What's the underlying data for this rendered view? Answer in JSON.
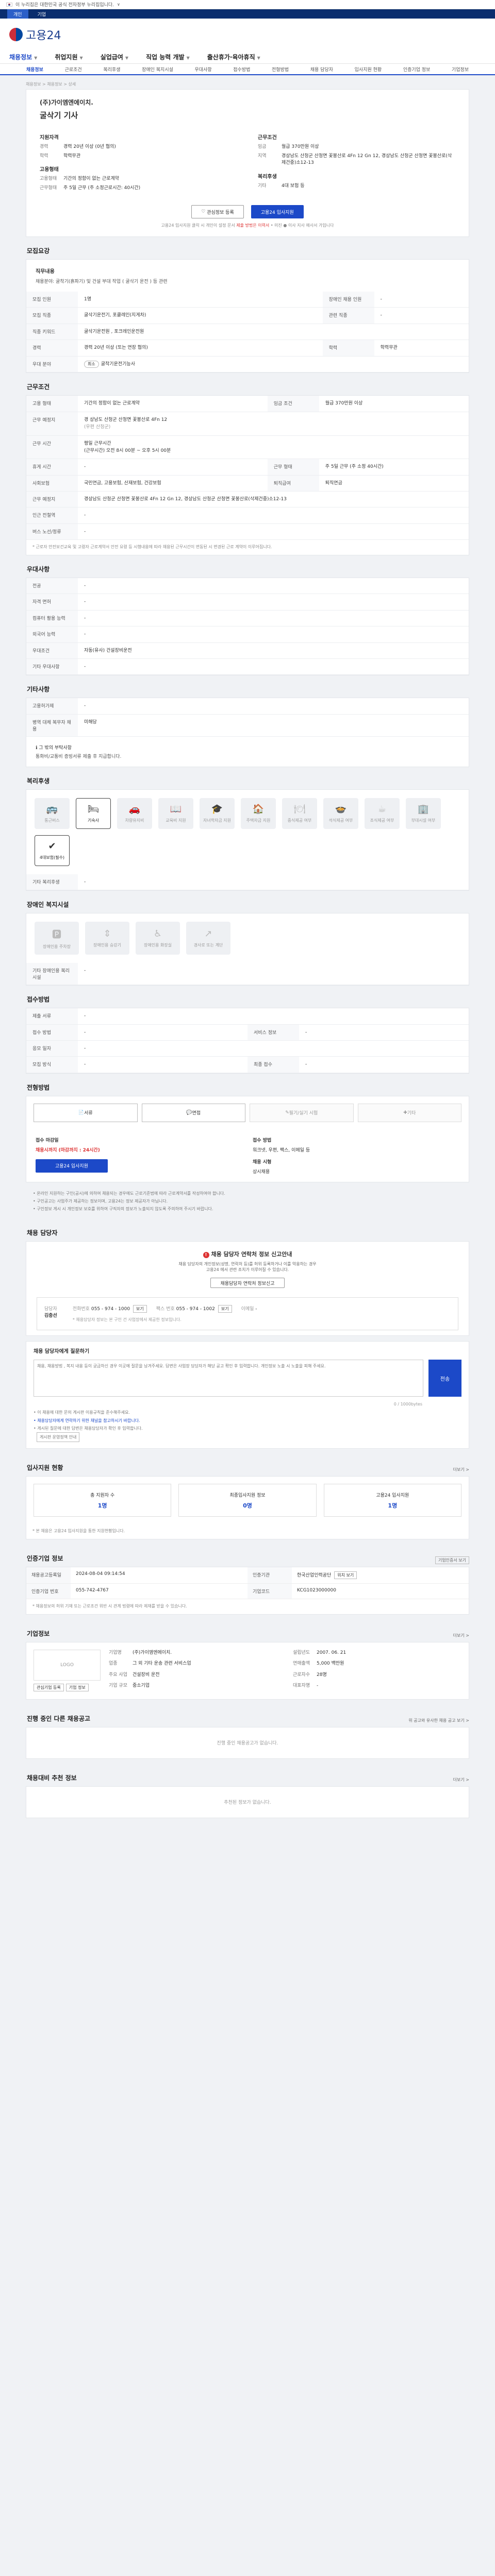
{
  "gov": {
    "text": "이 누리집은 대한민국 공식 전자정부 누리집입니다.",
    "arrow": "∨"
  },
  "topbar": {
    "items": [
      "개인",
      "기업"
    ]
  },
  "logo": {
    "name": "고용24"
  },
  "gnb": {
    "items": [
      "채용정보",
      "취업지원",
      "실업급여",
      "직업 능력 개발",
      "출산휴가·육아휴직"
    ]
  },
  "subnav": {
    "items": [
      "채용정보",
      "근로조건",
      "복리후생",
      "장애인 복지시설",
      "우대사항",
      "접수방법",
      "전형방법",
      "채용 담당자",
      "입사지원 현황",
      "인증기업 정보",
      "기업정보"
    ]
  },
  "crumb": "채용정보 > 채용정보 > 상세",
  "summary": {
    "company": "(주)가이엠엔에이치.",
    "title": "굴삭기 기사",
    "left": {
      "title": "지원자격",
      "rows": [
        [
          "경력",
          "경력 20년 이상 (0년 협의)"
        ],
        [
          "학력",
          "학력무관"
        ]
      ],
      "title2": "고용형태",
      "rows2": [
        [
          "고용형태",
          "기간의 정함이 없는 근로계약"
        ],
        [
          "근무형태",
          "주 5일 근무 (주 소정근로시간: 40시간)"
        ]
      ]
    },
    "right": {
      "title": "근무조건",
      "rows": [
        [
          "임금",
          "월급 370만원 이상"
        ],
        [
          "지역",
          "경상남도 산청군 산청면 꽃봉산로 4Fn 12 Gn 12, 경상남도 산청군 산청면 꽃봉산로(삭제건중)소12-13"
        ]
      ],
      "title2": "복리후생",
      "rows2": [
        [
          "기타",
          "4대 보험 등"
        ]
      ]
    },
    "btn1": "관심정보 등록",
    "btn2": "고용24 입사지원",
    "note": "고용24 입사지원 클릭 시 개인이 설정 문서 ",
    "warn": "제출 방법은 이력서 ",
    "note2": "• 미진 ● 이사 지사 애사서 가입니다"
  },
  "recruit": {
    "heading": "모집요강",
    "job_title": "직무내용",
    "job_text": "채용분야: 굴착기(흙파기) 및 건설 부대 작업 ( 굴삭기 운전 ) 등 관련",
    "rows": [
      [
        "모집 인원",
        "1명",
        "장애인 채용 인원",
        "-"
      ],
      [
        "모집 직종",
        "굴삭기운전기, 포클레인(지게차)",
        "관련 직종",
        "-"
      ],
      [
        "직종 키워드",
        "굴삭기운전원 , 포크레인운전원",
        "",
        ""
      ],
      [
        "경력",
        "경력 20년 이상 (또는 연장 협의)",
        "학력",
        "학력무관"
      ],
      [
        "우대 분야",
        "",
        "",
        ""
      ]
    ],
    "tag": "최소",
    "tagtext": "굴착기운전기능사"
  },
  "cond": {
    "heading": "근무조건",
    "r1": [
      "고용 형태",
      "기간의 정함이 없는 근로계약",
      "임금 조건",
      "월급 370만원 이상"
    ],
    "r2k": "근무 예정지",
    "r2a": "경 상남도 산청군 산청면 꽃봉산로 4Fn 12",
    "r2b": "(우편 산청군)",
    "r3k": "근무 시간",
    "r3a": "평일 근무시간",
    "r3b": "(근무시간) 오전 8시 00분 ~ 오후 5시 00분",
    "rows": [
      [
        "휴게 시간",
        "-",
        "근무 형태",
        "주 5일 근무 (주 소정 40시간)"
      ],
      [
        "사회보험",
        "국민연금, 고용보험, 산재보험, 건강보험",
        "퇴직급여",
        "퇴직연금"
      ],
      [
        "근무 예정지",
        "경상남도 산청군 산청면 꽃봉산로 4Fn 12 Gn 12, 경상남도 산청군 산청면 꽃봉산로(삭제건중)소12-13",
        "",
        ""
      ],
      [
        "인근 전철역",
        "-",
        "",
        ""
      ],
      [
        "버스 노선/정류",
        "-",
        "",
        ""
      ]
    ],
    "note": "* 근로자 안전보건교육 및 고령자 근로계약서 안전 요령 등 시행내용에 따라 채용된 근무시간이 변동된 시 변경된 근로 계약이 이루어집니다."
  },
  "prefer": {
    "heading": "우대사항",
    "rows": [
      [
        "전공",
        "-"
      ],
      [
        "자격 면허",
        "-"
      ],
      [
        "컴퓨터 활용 능력",
        "-"
      ],
      [
        "외국어 능력",
        "-"
      ],
      [
        "우대조건",
        "자동(유사) 건설장비운전"
      ],
      [
        "기타 우대사항",
        "-"
      ]
    ]
  },
  "etc": {
    "heading": "기타사항",
    "rows": [
      [
        "고용허가제",
        "-"
      ],
      [
        "병역 대체 복무자 채용",
        "미해당"
      ]
    ],
    "head2": "그 밖의 부탁사항",
    "text2": "통화비/교통비 증빙서류 제출 후 지급합니다."
  },
  "welfare": {
    "heading": "복리후생",
    "items": [
      "통근버스",
      "기숙사",
      "차량유지비",
      "교육비 지원",
      "자녀학자금 지원",
      "주택자금 지원",
      "중식제공 여부",
      "석식제공 여부",
      "조식제공 여부",
      "부대시설 여부",
      "4대보험(필수)"
    ],
    "on": [
      1,
      10
    ],
    "glyphs": [
      "🚌",
      "🛏",
      "🚗",
      "📖",
      "🎓",
      "🏠",
      "🍽",
      "🍲",
      "☕",
      "🏢",
      "✔"
    ],
    "row2k": "기타 복리후생",
    "row2v": "-"
  },
  "disab": {
    "heading": "장애인 복지시설",
    "items": [
      "장애인용 주차장",
      "장애인용 승강기",
      "장애인용 화장실",
      "경사로 또는 계단"
    ],
    "glyphs": [
      "🅿",
      "⇕",
      "♿",
      "↗"
    ],
    "row2k": "기타 장애인용 복리시설",
    "row2v": "-"
  },
  "apply": {
    "heading": "접수방법",
    "rows": [
      [
        "제출 서류",
        "-"
      ],
      [
        "접수 방법",
        "-",
        "서비스 정보",
        "-"
      ],
      [
        "응모 일자",
        "-"
      ],
      [
        "모집 방식",
        "-",
        "최종 접수",
        "-"
      ]
    ]
  },
  "screening": {
    "heading": "전형방법",
    "steps": [
      "서류",
      "면접",
      "필기/실기 시험",
      "기타"
    ],
    "glyphs": [
      "📄",
      "💬",
      "✎",
      "✚"
    ],
    "deadline_label": "접수 마감일",
    "deadline": "채용시까지 (마감까지 : 24시간)",
    "method_label": "접수 방법",
    "method": "워크넷, 우편, 팩스, 이메일 등",
    "btn": "고용24 입사지원",
    "type_label": "채용 시형",
    "type": "상시채용"
  },
  "screening_notes": [
    "• 온라인 지원하는 구인(공시)에 의하여 채용되는 경우에도 근로기준법에 따라 근로계약서를 작성하여야 합니다.",
    "• 구인공고는 사업주가 제공하는 정보이며, 고용24는 정보 제공자가 아닙니다.",
    "• 구인정보 게시 시 개인정보 보호를 위하여 구직자의 정보가 노출되지 않도록 주의하여 주시기 바랍니다."
  ],
  "contact": {
    "heading": "채용 담당자",
    "warn": "채용 담당자 연락처 정보 신고안내",
    "w1": "채용 담당자의 개인정보(성명, 연락처 등)를 허위 등록하거나 이를 악용하는 경우",
    "w2": "고용24 에서 관련 조치가 이루어질 수 있습니다.",
    "wbtn": "채용담당자 연락처 정보신고",
    "name_k": "담당자",
    "name_v": "김충선",
    "phone_k": "전화번호",
    "phone_v": "055 - 974 - 1000",
    "fax_k": "팩스 번호",
    "fax_v": "055 - 974 - 1002",
    "email_k": "이메일",
    "email_v": "-",
    "pbtn": "보기",
    "note": "* 채용담당자 정보는 본 구인 건 사업장에서 제공한 정보입니다."
  },
  "qa": {
    "heading": "채용 담당자에게 질문하기",
    "placeholder": "채용, 채용방법 , 복지 내용 등이 궁금하신 경우 이곳에 질문을 남겨주세요. 답변은 사업장 담당자가 해당 공고 확인 후 입력합니다. 개인정보 노출 시 노출을 피해 주세요.",
    "counter": "0 / 1000bytes",
    "send": "전송",
    "notes": [
      "• 이 채용에 대한 문의 게시판 이용규칙을 준수해주세요.",
      "• 채용담당자에게 연락하기 위한 채널을 참고하시기 바랍니다.",
      "• 게시된 질문에 대한 답변은 채용담당자가 확인 후 입력합니다."
    ],
    "link": "게시판 운영정책 안내"
  },
  "stats": {
    "heading": "입사지원 현황",
    "more": "더보기 >",
    "items": [
      [
        "총 지원자 수",
        "1명"
      ],
      [
        "최종입사지원 정보",
        "0명"
      ],
      [
        "고용24 입사지원",
        "1명"
      ]
    ],
    "note": "* 본 채용은 고용24 입사지원을 통한 지원현황입니다."
  },
  "cert": {
    "heading": "인증기업 정보",
    "btn": "기업인증서 보기",
    "rows": [
      [
        "채용공고등록일",
        "2024-08-04 09:14:54",
        "인증기관",
        "한국산업인력공단"
      ],
      [
        "인증기업 번호",
        "055-742-4767",
        "기업코드",
        "KCG1023000000"
      ]
    ],
    "sbtn": "위치 보기",
    "note": "* 채용정보의 허위 기재 또는 근로조건 위반 시 관계 법령에 따라 제재를 받을 수 있습니다."
  },
  "company": {
    "heading": "기업정보",
    "more": "더보기 >",
    "logo": "LOGO",
    "btn1": "관심기업 등록",
    "btn2": "기업 정보",
    "rows": [
      [
        "기업명",
        "(주)가이엠엔에이치."
      ],
      [
        "업종",
        "그 외 기타 운송 관련 서비스업"
      ],
      [
        "주요 사업",
        "건설장비 운전"
      ],
      [
        "기업 규모",
        "중소기업"
      ],
      [
        "설립년도",
        "2007. 06. 21"
      ],
      [
        "연매출액",
        "5,000 백만원"
      ],
      [
        "근로자수",
        "28명"
      ],
      [
        "대표자명",
        "-"
      ]
    ]
  },
  "similar": {
    "heading": "진행 중인 다른 채용공고",
    "more": "위 공고와 유사한 채용 공고 보기 >",
    "empty": "진행 중인 채용공고가 없습니다."
  },
  "recommend": {
    "heading": "채용대비 추천 정보",
    "more": "더보기 >",
    "empty": "추천된 정보가 없습니다."
  }
}
